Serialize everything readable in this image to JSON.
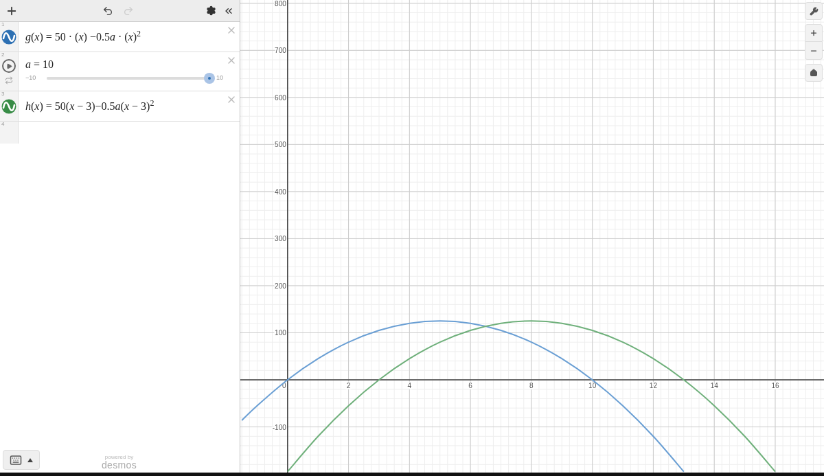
{
  "toolbar": {
    "redo_disabled": true
  },
  "expressions": [
    {
      "kind": "function",
      "number": "1",
      "parts": [
        {
          "text": "g",
          "italic": true
        },
        {
          "text": "(",
          "italic": false
        },
        {
          "text": "x",
          "italic": true
        },
        {
          "text": ") = 50 · (",
          "italic": false
        },
        {
          "text": "x",
          "italic": true
        },
        {
          "text": ") −0.5",
          "italic": false
        },
        {
          "text": "a",
          "italic": true
        },
        {
          "text": " · (",
          "italic": false
        },
        {
          "text": "x",
          "italic": true
        },
        {
          "text": ")$^{2}$",
          "italic": false
        }
      ],
      "color": "#2d70b3"
    },
    {
      "kind": "slider",
      "number": "2",
      "parts": [
        {
          "text": "a",
          "italic": true
        },
        {
          "text": " = 10",
          "italic": false
        }
      ],
      "min": "−10",
      "max": "10",
      "level": 1.0
    },
    {
      "kind": "function",
      "number": "3",
      "parts": [
        {
          "text": "h",
          "italic": true
        },
        {
          "text": "(",
          "italic": false
        },
        {
          "text": "x",
          "italic": true
        },
        {
          "text": ") = 50(",
          "italic": false
        },
        {
          "text": "x",
          "italic": true
        },
        {
          "text": " − 3)−0.5",
          "italic": false
        },
        {
          "text": "a",
          "italic": true
        },
        {
          "text": "(",
          "italic": false
        },
        {
          "text": "x",
          "italic": true
        },
        {
          "text": " − 3)$^{2}$",
          "italic": false
        }
      ],
      "color": "#388c46"
    },
    {
      "kind": "empty",
      "number": "4"
    }
  ],
  "footer": {
    "powered_by": "powered by",
    "brand": "desmos"
  },
  "graph": {
    "chart_data": {
      "type": "line",
      "grid": true,
      "x": [
        -1.5,
        -1,
        0,
        1,
        2,
        3,
        4,
        5,
        6,
        7,
        8,
        9,
        10,
        11,
        12,
        13,
        14,
        15,
        16
      ],
      "series": [
        {
          "color": "#6a9fd4",
          "values": [
            -86,
            -55,
            0,
            45,
            80,
            105,
            120,
            125,
            120,
            105,
            80,
            45,
            0,
            -55,
            -120,
            -195,
            null,
            null,
            null
          ]
        },
        {
          "color": "#6fb07b",
          "values": [
            null,
            null,
            -195,
            -120,
            -55,
            0,
            45,
            80,
            105,
            120,
            125,
            120,
            105,
            80,
            45,
            0,
            -55,
            -120,
            -195
          ]
        }
      ],
      "xlim": [
        -1.55,
        17.6
      ],
      "ylim": [
        -197,
        807
      ],
      "xticks": [
        {
          "value": 0,
          "label": "0"
        },
        {
          "value": 2,
          "label": "2"
        },
        {
          "value": 4,
          "label": "4"
        },
        {
          "value": 6,
          "label": "6"
        },
        {
          "value": 8,
          "label": "8"
        },
        {
          "value": 10,
          "label": "10"
        },
        {
          "value": 12,
          "label": "12"
        },
        {
          "value": 14,
          "label": "14"
        },
        {
          "value": 16,
          "label": "16"
        }
      ],
      "yticks": [
        {
          "value": -100,
          "label": "-100"
        },
        {
          "value": 100,
          "label": "100"
        },
        {
          "value": 200,
          "label": "200"
        },
        {
          "value": 300,
          "label": "300"
        },
        {
          "value": 400,
          "label": "400"
        },
        {
          "value": 500,
          "label": "500"
        },
        {
          "value": 600,
          "label": "600"
        },
        {
          "value": 700,
          "label": "700"
        },
        {
          "value": 800,
          "label": "800"
        }
      ]
    }
  }
}
